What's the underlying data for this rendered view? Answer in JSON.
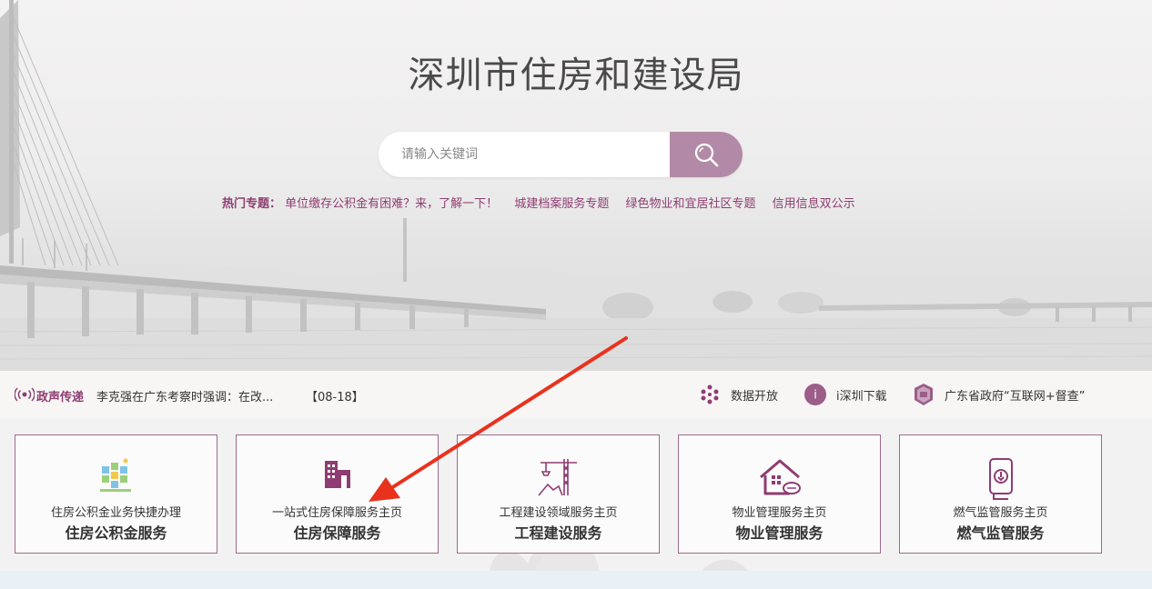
{
  "header": {
    "title": "深圳市住房和建设局"
  },
  "search": {
    "placeholder": "请输入关键词",
    "button_icon": "search-icon"
  },
  "hot_topics": {
    "label": "热门专题：",
    "items": [
      "单位缴存公积金有困难？来，了解一下！",
      "城建档案服务专题",
      "绿色物业和宜居社区专题",
      "信用信息双公示"
    ]
  },
  "news": {
    "label": "政声传递",
    "headline": "李克强在广东考察时强调：在改...",
    "date": "【08-18】"
  },
  "quick_links": [
    {
      "label": "数据开放",
      "icon": "data-dots-icon"
    },
    {
      "label": "i深圳下载",
      "icon": "i-shenzhen-icon"
    },
    {
      "label": "广东省政府“互联网+督查”",
      "icon": "supervision-badge-icon"
    }
  ],
  "cards": [
    {
      "sub": "住房公积金业务快捷办理",
      "main": "住房公积金服务",
      "icon": "housing-fund-icon"
    },
    {
      "sub": "一站式住房保障服务主页",
      "main": "住房保障服务",
      "icon": "building-icon"
    },
    {
      "sub": "工程建设领域服务主页",
      "main": "工程建设服务",
      "icon": "crane-icon"
    },
    {
      "sub": "物业管理服务主页",
      "main": "物业管理服务",
      "icon": "house-icon"
    },
    {
      "sub": "燃气监管服务主页",
      "main": "燃气监管服务",
      "icon": "gas-meter-icon"
    }
  ],
  "colors": {
    "accent": "#8e3d72",
    "search_button": "#b28aa7",
    "card_border": "#9e6a8d",
    "annotation_arrow": "#e8321e"
  }
}
